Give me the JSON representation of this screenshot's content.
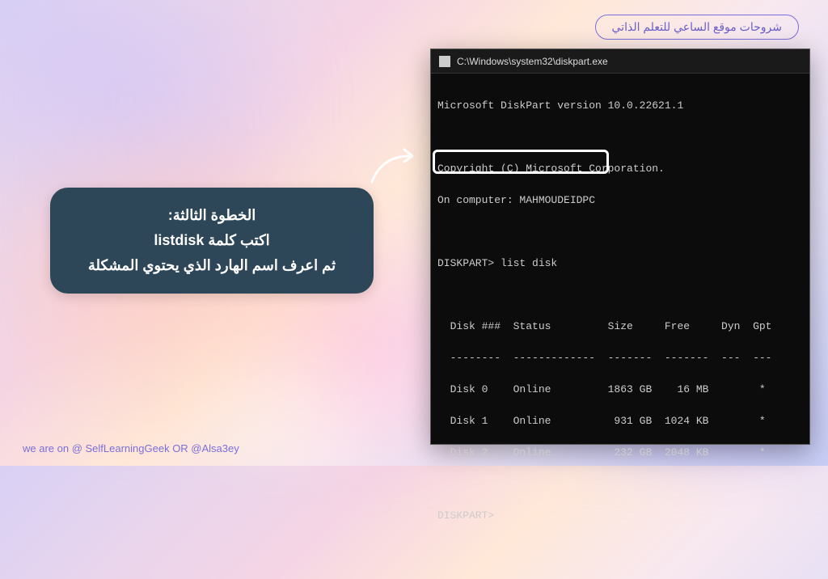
{
  "badge_text": "شروحات موقع الساعي للتعلم الذاتي",
  "footer_text": "we are on @ SelfLearningGeek OR @Alsa3ey",
  "callout": {
    "line1": "الخطوة الثالثة:",
    "line2_pre": "اكتب كلمة ",
    "line2_cmd": "listdisk",
    "line3": "ثم اعرف اسم الهارد الذي يحتوي المشكلة"
  },
  "terminal": {
    "title_path": "C:\\Windows\\system32\\diskpart.exe",
    "version_line": "Microsoft DiskPart version 10.0.22621.1",
    "copyright_line": "Copyright (C) Microsoft Corporation.",
    "computer_line": "On computer: MAHMOUDEIDPC",
    "prompt_cmd": "DISKPART> list disk",
    "header": "  Disk ###  Status         Size     Free     Dyn  Gpt",
    "divider": "  --------  -------------  -------  -------  ---  ---",
    "rows": [
      "  Disk 0    Online         1863 GB    16 MB        *",
      "  Disk 1    Online          931 GB  1024 KB        *",
      "  Disk 2    Online          232 GB  2048 KB        *"
    ],
    "prompt_empty": "DISKPART>"
  }
}
